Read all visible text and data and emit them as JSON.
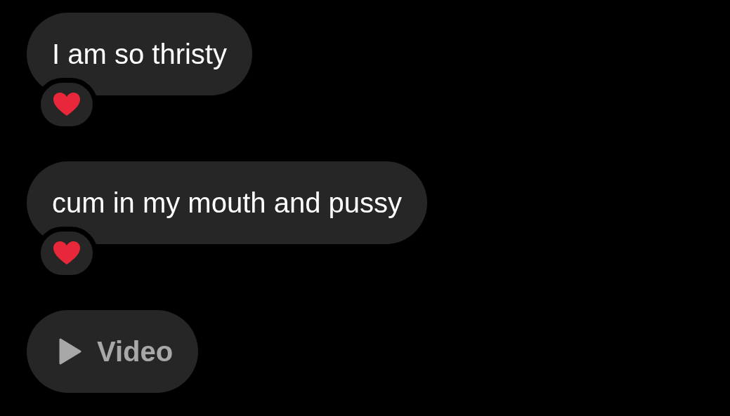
{
  "messages": [
    {
      "kind": "text",
      "text": "I am so thristy",
      "reacted": true
    },
    {
      "kind": "text",
      "text": "cum in my mouth and pussy",
      "reacted": true
    },
    {
      "kind": "video",
      "text": "Video",
      "reacted": false
    }
  ]
}
